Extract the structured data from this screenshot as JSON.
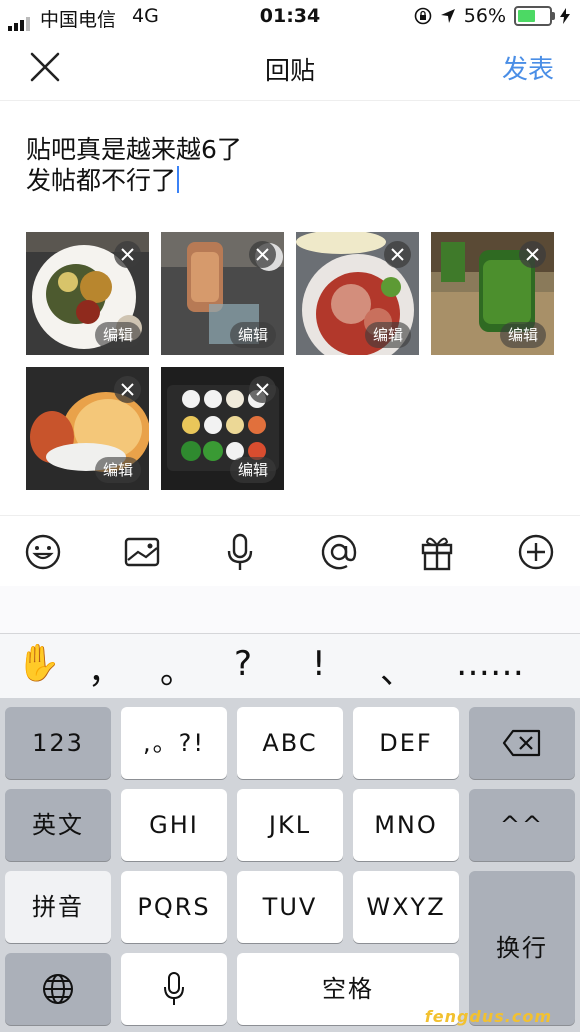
{
  "status_bar": {
    "carrier": "中国电信",
    "network": "4G",
    "time": "01:34",
    "battery_text": "56%",
    "battery_level": 0.56,
    "battery_color": "#4cd964"
  },
  "nav": {
    "title": "回贴",
    "post_label": "发表",
    "close_icon": "close-icon",
    "accent_color": "#4a8ee6"
  },
  "post": {
    "line1": "贴吧真是越来越6了",
    "line2": "发帖都不行了"
  },
  "photos": [
    {
      "edit_label": "编辑",
      "icon": "close-icon"
    },
    {
      "edit_label": "编辑",
      "icon": "close-icon"
    },
    {
      "edit_label": "编辑",
      "icon": "close-icon"
    },
    {
      "edit_label": "编辑",
      "icon": "close-icon"
    },
    {
      "edit_label": "编辑",
      "icon": "close-icon"
    },
    {
      "edit_label": "编辑",
      "icon": "close-icon"
    }
  ],
  "toolbar": {
    "icons": [
      "emoji-icon",
      "image-icon",
      "microphone-icon",
      "at-icon",
      "gift-icon",
      "add-icon"
    ]
  },
  "candidates": {
    "emoji": "✋",
    "items": [
      "，",
      "。",
      "?",
      "!",
      "、",
      "……"
    ]
  },
  "keyboard": {
    "num": "123",
    "punct": ",。?!",
    "abc": "ABC",
    "def": "DEF",
    "eng": "英文",
    "ghi": "GHI",
    "jkl": "JKL",
    "mno": "MNO",
    "face": "^^",
    "pinyin": "拼音",
    "pqrs": "PQRS",
    "tuv": "TUV",
    "wxyz": "WXYZ",
    "enter": "换行",
    "space": "空格",
    "icons": [
      "backspace-icon",
      "globe-icon",
      "microphone-icon"
    ]
  },
  "watermark": "fengdus.com"
}
